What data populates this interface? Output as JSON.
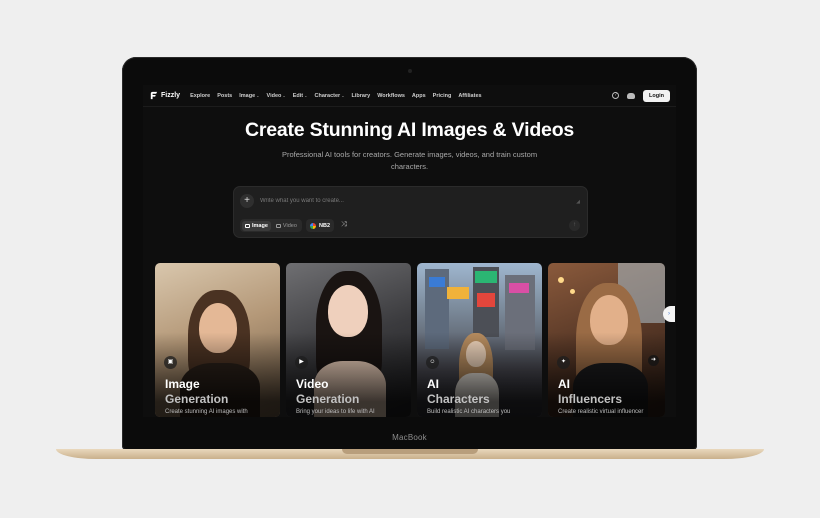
{
  "device": {
    "brand": "MacBook"
  },
  "app": {
    "name": "Fizzly"
  },
  "nav": {
    "items": [
      {
        "label": "Explore",
        "caret": false
      },
      {
        "label": "Posts",
        "caret": false
      },
      {
        "label": "Image",
        "caret": true
      },
      {
        "label": "Video",
        "caret": true
      },
      {
        "label": "Edit",
        "caret": true
      },
      {
        "label": "Character",
        "caret": true
      },
      {
        "label": "Library",
        "caret": false
      },
      {
        "label": "Workflows",
        "caret": false
      },
      {
        "label": "Apps",
        "caret": false
      },
      {
        "label": "Pricing",
        "caret": false
      },
      {
        "label": "Affiliates",
        "caret": false
      }
    ],
    "login_label": "Login"
  },
  "hero": {
    "title": "Create Stunning AI Images & Videos",
    "subtitle": "Professional AI tools for creators. Generate images, videos, and train custom characters."
  },
  "prompt": {
    "placeholder": "Write what you want to create...",
    "modes": [
      {
        "label": "Image",
        "active": true
      },
      {
        "label": "Video",
        "active": false
      }
    ],
    "model_label": "NB2"
  },
  "cards": [
    {
      "title1": "Image",
      "title2": "Generation",
      "desc": "Create stunning AI images with",
      "icon": "image-icon",
      "glyph": "▣"
    },
    {
      "title1": "Video",
      "title2": "Generation",
      "desc": "Bring your ideas to life with AI",
      "icon": "video-icon",
      "glyph": "▶"
    },
    {
      "title1": "AI",
      "title2": "Characters",
      "desc": "Build realistic AI characters you",
      "icon": "users-icon",
      "glyph": "☺"
    },
    {
      "title1": "AI",
      "title2": "Influencers",
      "desc": "Create realistic virtual influencer",
      "icon": "sparkle-icon",
      "glyph": "✦"
    }
  ]
}
